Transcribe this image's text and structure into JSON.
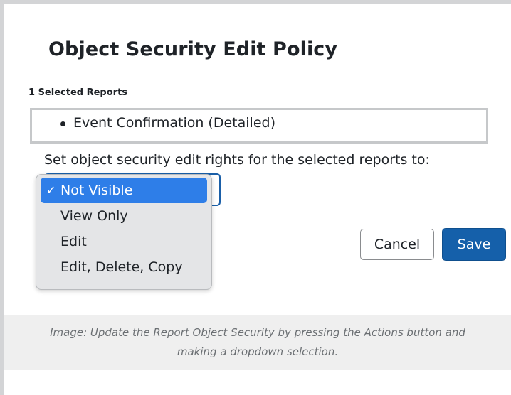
{
  "dialog": {
    "title": "Object Security Edit Policy",
    "selected_count": "1 Selected Reports",
    "reports": [
      "Event Confirmation (Detailed)"
    ],
    "instruction": "Set object security edit rights for the selected reports to:",
    "dropdown": {
      "selected_value": "Not Visible",
      "options": [
        "Not Visible",
        "View Only",
        "Edit",
        "Edit, Delete, Copy"
      ],
      "check_glyph": "✓"
    },
    "cancel_label": "Cancel",
    "save_label": "Save"
  },
  "caption": {
    "line1": "Image: Update the Report Object Security by pressing the Actions button and",
    "line2": "making a dropdown selection."
  },
  "colors": {
    "primary_button": "#1560aa",
    "dropdown_highlight": "#2e7ee8",
    "select_focus_border": "#1a5fa8"
  },
  "icons": {
    "check": "check-icon"
  }
}
